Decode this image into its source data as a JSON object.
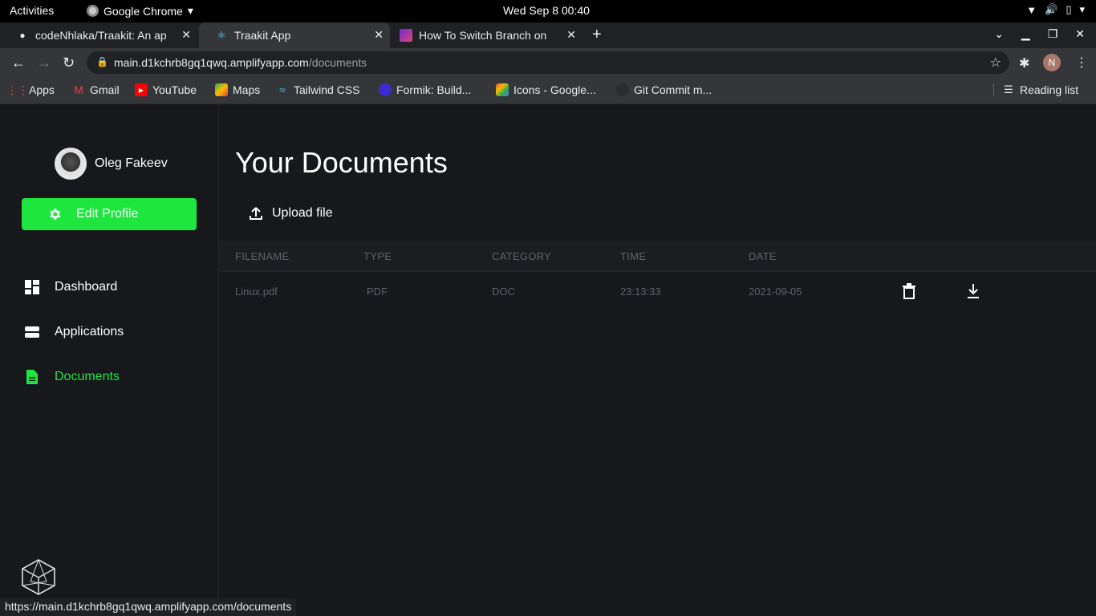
{
  "system": {
    "activities": "Activities",
    "app_name": "Google Chrome",
    "clock": "Wed Sep 8  00:40"
  },
  "tabs": [
    {
      "label": "codeNhlaka/Traakit: An ap",
      "favicon": "github-icon"
    },
    {
      "label": "Traakit App",
      "favicon": "react-icon"
    },
    {
      "label": "How To Switch Branch on",
      "favicon": "tutorial-icon"
    }
  ],
  "address": {
    "host": "main.d1kchrb8gq1qwq.amplifyapp.com",
    "path": "/documents"
  },
  "profile_initial": "N",
  "bookmarks": [
    {
      "label": "Apps",
      "color": "#ea4335"
    },
    {
      "label": "Gmail",
      "color": "#ea4335"
    },
    {
      "label": "YouTube",
      "color": "#ff0000"
    },
    {
      "label": "Maps",
      "color": "#34a853"
    },
    {
      "label": "Tailwind CSS",
      "color": "#38bdf8"
    },
    {
      "label": "Formik: Build...",
      "color": "#3b2bd1"
    },
    {
      "label": "Icons - Google...",
      "color": "#fbbc04"
    },
    {
      "label": "Git Commit m...",
      "color": "#444"
    }
  ],
  "reading_list": "Reading list",
  "sidebar": {
    "user_name": "Oleg Fakeev",
    "edit_profile": "Edit Profile",
    "accent": "#1ee63f",
    "items": [
      {
        "label": "Dashboard",
        "icon": "dashboard-icon"
      },
      {
        "label": "Applications",
        "icon": "applications-icon"
      },
      {
        "label": "Documents",
        "icon": "document-icon",
        "active": true
      }
    ]
  },
  "main": {
    "title": "Your Documents",
    "upload_label": "Upload file",
    "columns": [
      "FILENAME",
      "TYPE",
      "CATEGORY",
      "TIME",
      "DATE"
    ],
    "rows": [
      {
        "filename": "Linux.pdf",
        "type": "PDF",
        "category": "DOC",
        "time": "23:13:33",
        "date": "2021-09-05"
      }
    ]
  },
  "status_url": "https://main.d1kchrb8gq1qwq.amplifyapp.com/documents"
}
